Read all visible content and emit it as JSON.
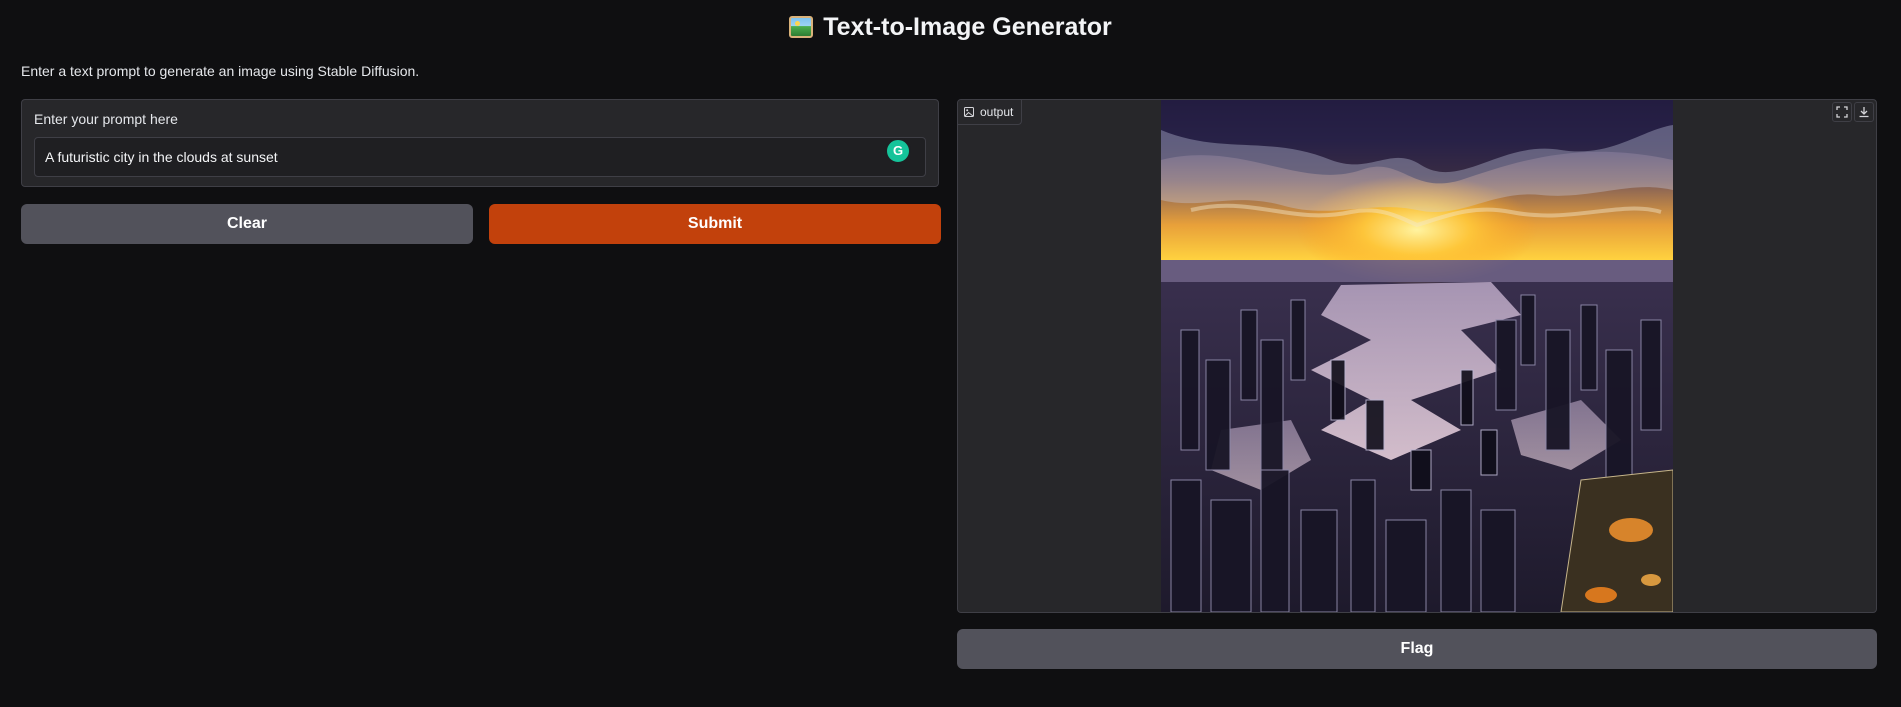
{
  "header": {
    "title": "Text-to-Image Generator",
    "emoji_icon": "framed-picture-icon"
  },
  "description": "Enter a text prompt to generate an image using Stable Diffusion.",
  "prompt": {
    "label": "Enter your prompt here",
    "value": "A futuristic city in the clouds at sunset",
    "grammarly_badge": "G"
  },
  "buttons": {
    "clear": "Clear",
    "submit": "Submit",
    "flag": "Flag"
  },
  "output": {
    "label": "output",
    "icons": [
      "image-icon",
      "fullscreen-icon",
      "download-icon"
    ]
  },
  "colors": {
    "background": "#0f0f11",
    "panel": "#27272a",
    "border": "#3f3f46",
    "secondary_button": "#52525b",
    "primary_button": "#c2410c",
    "grammarly": "#15c39a"
  }
}
